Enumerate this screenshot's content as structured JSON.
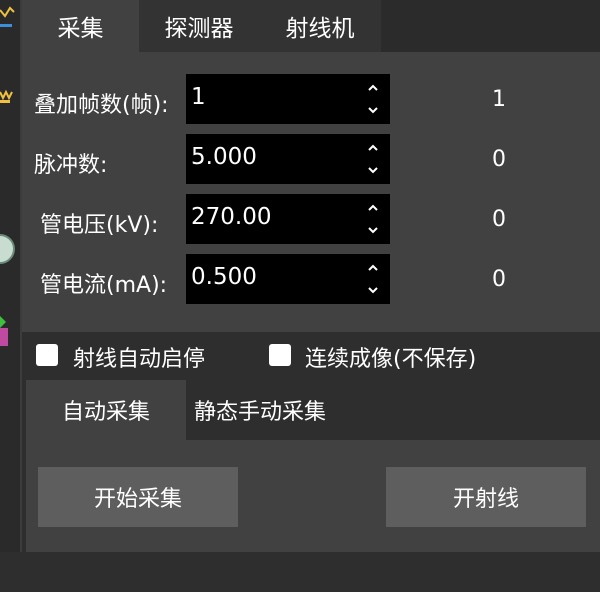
{
  "tabs": [
    "采集",
    "探测器",
    "射线机"
  ],
  "fields": [
    {
      "label": "叠加帧数(帧):",
      "value": "1",
      "readback": "1"
    },
    {
      "label": "脉冲数:",
      "value": "5.000",
      "readback": "0"
    },
    {
      "label": "管电压(kV):",
      "value": "270.00",
      "readback": "0"
    },
    {
      "label": "管电流(mA):",
      "value": "0.500",
      "readback": "0"
    }
  ],
  "checkboxes": [
    {
      "label": "射线自动启停",
      "checked": false
    },
    {
      "label": "连续成像(不保存)",
      "checked": false
    }
  ],
  "subtabs": [
    "自动采集",
    "静态手动采集"
  ],
  "buttons": {
    "start_capture": "开始采集",
    "start_ray": "开射线"
  },
  "colors": {
    "panel": "#414141",
    "background": "#2e2e2e",
    "input_bg": "#000000",
    "button": "#5e5e5e",
    "icon_accent": "#f0c040",
    "icon_blue": "#3a8fd8"
  }
}
